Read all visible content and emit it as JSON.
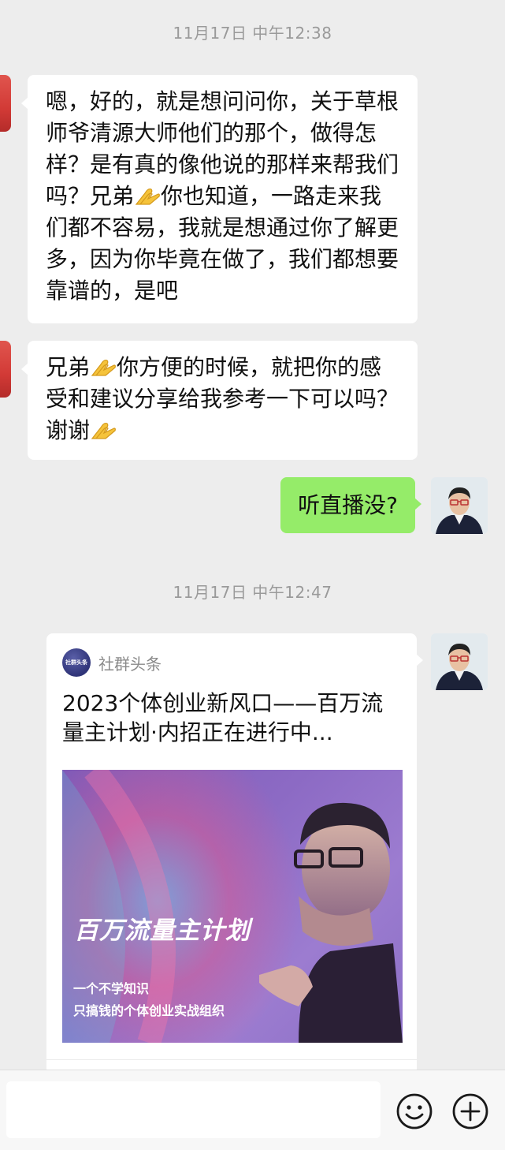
{
  "chat": {
    "timestamps": [
      "11月17日 中午12:38",
      "11月17日 中午12:47"
    ],
    "messages": {
      "m1_parts": [
        "嗯，好的，就是想问问你，关于草根师爷清源大师他们的那个，做得怎样？是有真的像他说的那样来帮我们吗？兄弟",
        "你也知道，一路走来我们都不容易，我就是想通过你了解更多，因为你毕竟在做了，我们都想要靠谱的，是吧"
      ],
      "m2_parts": [
        "兄弟",
        "你方便的时候，就把你的感受和建议分享给我参考一下可以吗？谢谢"
      ],
      "m3": "听直播没?"
    },
    "card": {
      "source_name": "社群头条",
      "source_logo_text": "社群头条",
      "title": "2023个体创业新风口——百万流量主计划·内招正在进行中...",
      "image_title": "百万流量主计划",
      "image_sub_line1": "一个不学知识",
      "image_sub_line2": "只搞钱的个体创业实战组织"
    }
  },
  "input_bar": {
    "placeholder": "",
    "emoji_icon": "smiley-icon",
    "plus_icon": "plus-circle-icon"
  },
  "colors": {
    "background": "#ededed",
    "bubble_in": "#ffffff",
    "bubble_out": "#95ec69",
    "timestamp": "#9a9a9a"
  }
}
